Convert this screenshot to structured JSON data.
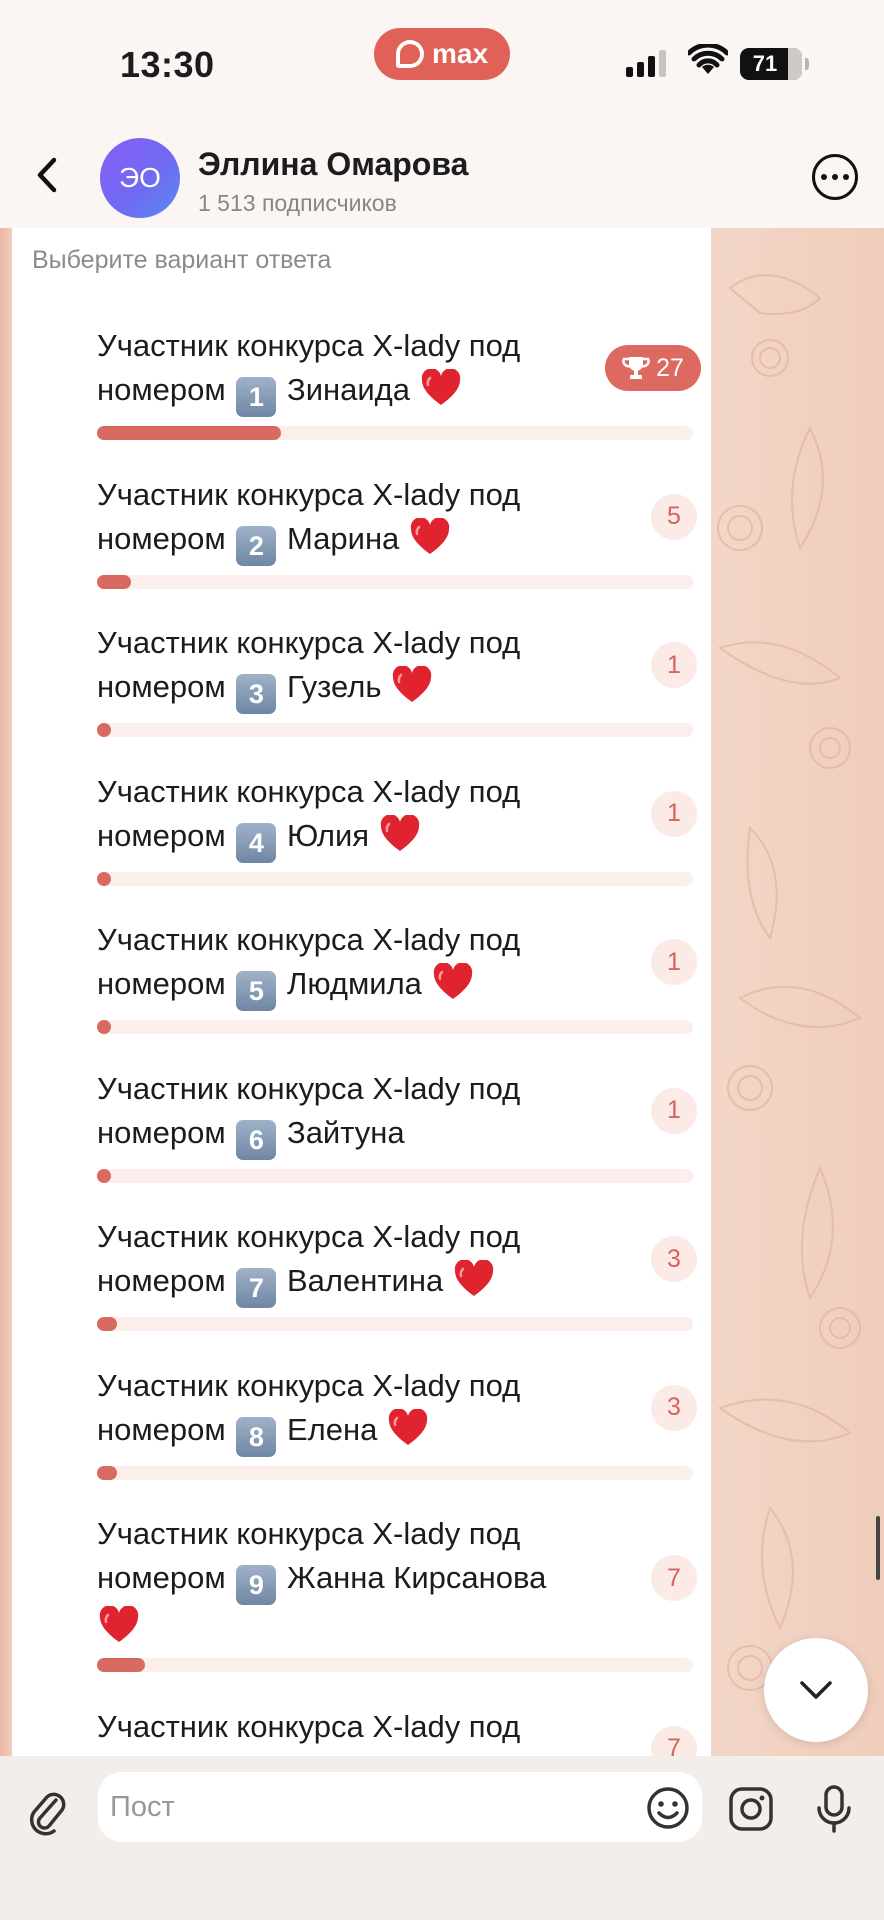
{
  "status_bar": {
    "time": "13:30",
    "app_badge": "max",
    "battery": "71"
  },
  "header": {
    "avatar_initials": "ЭО",
    "channel_name": "Эллина Омарова",
    "subscribers": "1 513 подписчиков"
  },
  "poll": {
    "hint": "Выберите вариант ответа",
    "max_votes": 27,
    "options": [
      {
        "line1": "Участник конкурса X-lady под",
        "prefix": "номером",
        "num": "1",
        "name": "Зинаида",
        "heart": true,
        "votes": 27,
        "winner": true
      },
      {
        "line1": "Участник конкурса X-lady под",
        "prefix": "номером",
        "num": "2",
        "name": "Марина",
        "heart": true,
        "votes": 5,
        "winner": false
      },
      {
        "line1": "Участник конкурса X-lady под",
        "prefix": "номером",
        "num": "3",
        "name": "Гузель",
        "heart": true,
        "votes": 1,
        "winner": false
      },
      {
        "line1": "Участник конкурса X-lady под",
        "prefix": "номером",
        "num": "4",
        "name": "Юлия",
        "heart": true,
        "votes": 1,
        "winner": false
      },
      {
        "line1": "Участник конкурса X-lady под",
        "prefix": "номером",
        "num": "5",
        "name": "Людмила",
        "heart": true,
        "votes": 1,
        "winner": false
      },
      {
        "line1": "Участник конкурса X-lady под",
        "prefix": "номером",
        "num": "6",
        "name": "Зайтуна",
        "heart": false,
        "votes": 1,
        "winner": false
      },
      {
        "line1": "Участник конкурса X-lady под",
        "prefix": "номером",
        "num": "7",
        "name": "Валентина",
        "heart": true,
        "votes": 3,
        "winner": false
      },
      {
        "line1": "Участник конкурса X-lady под",
        "prefix": "номером",
        "num": "8",
        "name": "Елена",
        "heart": true,
        "votes": 3,
        "winner": false
      },
      {
        "line1": "Участник конкурса X-lady под",
        "prefix": "номером",
        "num": "9",
        "name": "Жанна Кирсанова",
        "heart": true,
        "votes": 7,
        "winner": false
      },
      {
        "line1": "Участник конкурса X-lady под",
        "prefix": "",
        "num": "",
        "name": "",
        "heart": false,
        "votes": 7,
        "winner": false
      }
    ]
  },
  "composer": {
    "placeholder": "Пост"
  },
  "colors": {
    "accent": "#dc6a60",
    "bar_track": "#fbeeeb",
    "count_bg": "#fbeae6"
  },
  "icons": [
    "back-chevron-icon",
    "more-icon",
    "trophy-icon",
    "heart-icon",
    "chevron-down-icon",
    "paperclip-icon",
    "emoji-icon",
    "camera-icon",
    "microphone-icon",
    "wifi-icon",
    "signal-icon",
    "battery-icon"
  ]
}
